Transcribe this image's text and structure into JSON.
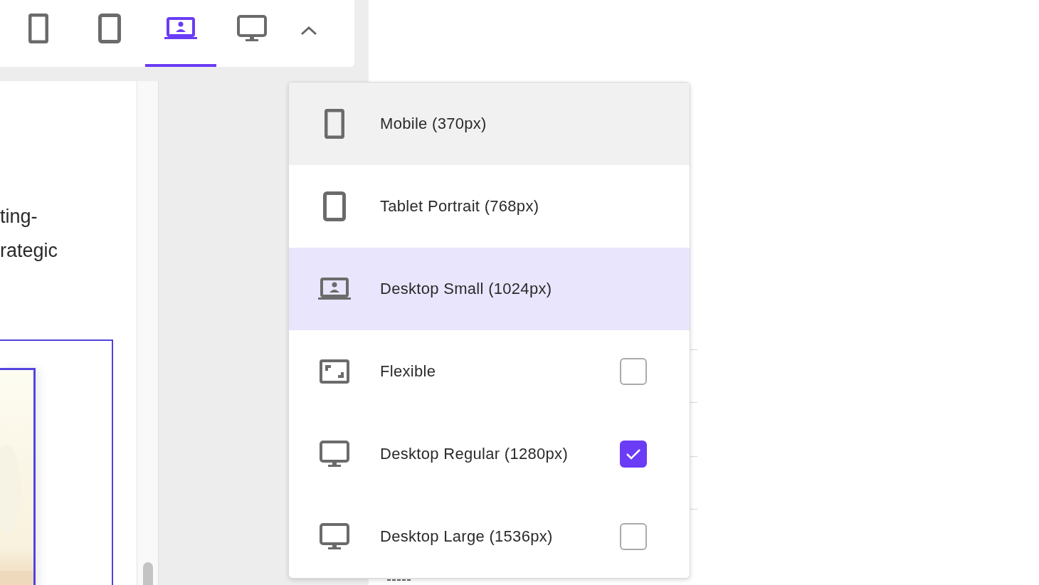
{
  "toolbar": {
    "tabs": [
      {
        "kind": "mobile",
        "selected": false
      },
      {
        "kind": "tablet",
        "selected": false
      },
      {
        "kind": "laptop",
        "selected": true
      },
      {
        "kind": "desktop",
        "selected": false
      }
    ]
  },
  "content": {
    "lines": [
      "ting-",
      "rategic"
    ]
  },
  "menu": {
    "items": [
      {
        "kind": "mobile",
        "label": "Mobile (370px)",
        "hovered": true,
        "selected": false
      },
      {
        "kind": "tablet",
        "label": "Tablet Portrait (768px)",
        "hovered": false,
        "selected": false
      },
      {
        "kind": "laptop",
        "label": "Desktop Small (1024px)",
        "hovered": false,
        "selected": true
      },
      {
        "kind": "flexible",
        "label": "Flexible",
        "hovered": false,
        "checked": false
      },
      {
        "kind": "desktop",
        "label": "Desktop Regular (1280px)",
        "hovered": false,
        "checked": true
      },
      {
        "kind": "desktop",
        "label": "Desktop Large (1536px)",
        "hovered": false,
        "checked": false
      }
    ]
  }
}
